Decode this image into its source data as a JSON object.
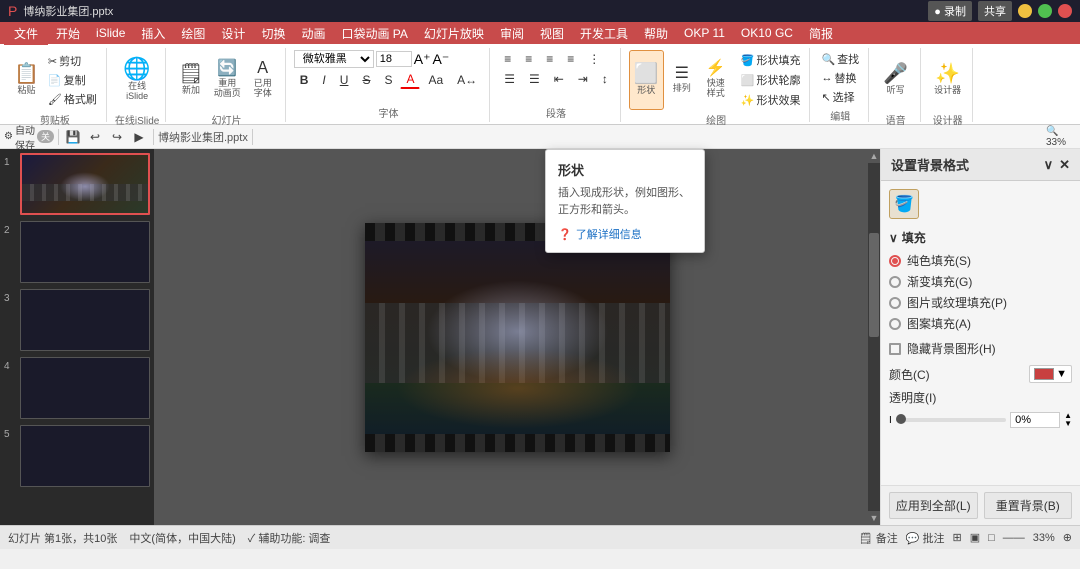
{
  "titlebar": {
    "filename": "博纳影业集团.pptx",
    "controls": [
      "minimize",
      "maximize",
      "close"
    ],
    "record_btn": "● 录制",
    "share_btn": "共享"
  },
  "menubar": {
    "items": [
      "开始",
      "iSlide",
      "插入",
      "绘图",
      "设计",
      "切换",
      "动画",
      "口袋动画 PA",
      "幻灯片放映",
      "审阅",
      "视图",
      "开发工具",
      "帮助",
      "OKP 11",
      "OK10 GC",
      "简报"
    ]
  },
  "ribbon": {
    "active_tab": "开始",
    "groups": [
      {
        "label": "剪贴板",
        "items": [
          {
            "icon": "📋",
            "label": "粘贴"
          },
          {
            "icon": "✂",
            "label": "剪切"
          },
          {
            "icon": "📄",
            "label": "复制"
          },
          {
            "icon": "🖌",
            "label": "格式刷"
          }
        ]
      },
      {
        "label": "在线iSlide",
        "items": [
          {
            "icon": "🌐",
            "label": "在线\niSlide"
          }
        ]
      },
      {
        "label": "幻灯片",
        "items": [
          {
            "icon": "➕",
            "label": "新加"
          },
          {
            "icon": "🔄",
            "label": "重用动画页"
          },
          {
            "icon": "📐",
            "label": "已用字体"
          }
        ]
      },
      {
        "label": "字体",
        "items": [
          {
            "label": "B",
            "type": "format"
          },
          {
            "label": "I",
            "type": "format"
          },
          {
            "label": "U",
            "type": "format"
          },
          {
            "label": "S",
            "type": "format"
          }
        ]
      },
      {
        "label": "段落",
        "items": []
      },
      {
        "label": "绘图",
        "items": [
          {
            "icon": "⬜",
            "label": "形状",
            "highlighted": true
          },
          {
            "icon": "≡",
            "label": "排列"
          },
          {
            "icon": "⚡",
            "label": "快速样式"
          }
        ]
      },
      {
        "label": "编辑",
        "items": [
          {
            "icon": "🔍",
            "label": "查找"
          },
          {
            "icon": "↔",
            "label": "替换"
          },
          {
            "icon": "↖",
            "label": "选择"
          }
        ]
      },
      {
        "label": "语音",
        "items": [
          {
            "icon": "🎤",
            "label": "听写"
          }
        ]
      },
      {
        "label": "设计器",
        "items": [
          {
            "icon": "✨",
            "label": "设计器"
          }
        ]
      }
    ]
  },
  "font_toolbar": {
    "font_name": "微软雅黑",
    "font_size": "18",
    "bold": "B",
    "italic": "I",
    "underline": "U",
    "strikethrough": "S",
    "font_color_label": "A",
    "align_left": "≡",
    "align_center": "≡",
    "align_right": "≡",
    "font_increase": "A↑",
    "font_decrease": "A↓",
    "font_size_label": "Aa"
  },
  "quick_toolbar": {
    "items": [
      "💾",
      "↩",
      "↪",
      "▶",
      "🖊",
      "📐"
    ]
  },
  "slide_panel": {
    "slides": [
      {
        "num": 1,
        "active": true
      },
      {
        "num": 2,
        "active": false
      },
      {
        "num": 3,
        "active": false
      },
      {
        "num": 4,
        "active": false
      },
      {
        "num": 5,
        "active": false
      }
    ]
  },
  "tooltip": {
    "title": "形状",
    "description": "插入现成形状，例如图形、正方形和箭头。",
    "link_text": "了解详细信息"
  },
  "right_panel": {
    "title": "设置背景格式",
    "close_btn": "✕",
    "collapse_btn": "∨",
    "icon_btn_active": 0,
    "fill_section": {
      "label": "填充",
      "options": [
        {
          "label": "纯色填充(S)",
          "checked": true
        },
        {
          "label": "渐变填充(G)",
          "checked": false
        },
        {
          "label": "图片或纹理填充(P)",
          "checked": false
        },
        {
          "label": "图案填充(A)",
          "checked": false
        }
      ],
      "checkbox": {
        "label": "隐藏背景图形(H)",
        "checked": false
      }
    },
    "color_row": {
      "label": "颜色(C)",
      "color": "#c84040"
    },
    "opacity_row": {
      "label": "透明度(I)",
      "value": "0%"
    },
    "footer": {
      "apply_all": "应用到全部(L)",
      "reset": "重置背景(B)"
    }
  },
  "status_bar": {
    "slide_info": "幻灯片 第1张，共10张",
    "lang": "中文(简体，中国大陆)",
    "accessibility": "✓ 辅助功能: 调查",
    "notes": "🗒 备注",
    "comments": "💬 批注",
    "zoom": "33%",
    "view_icons": [
      "⊞",
      "▣",
      "□"
    ]
  }
}
